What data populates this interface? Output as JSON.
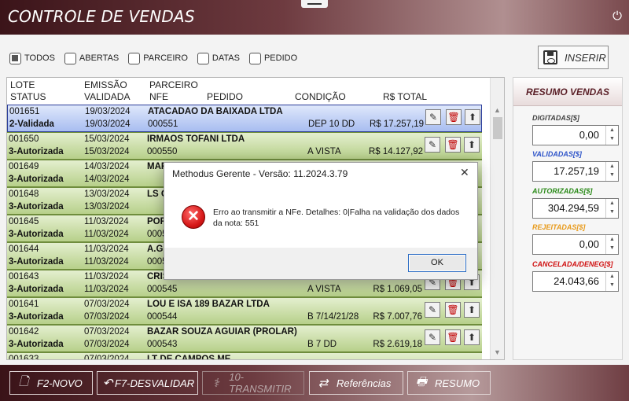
{
  "window": {
    "title": "CONTROLE DE VENDAS"
  },
  "filters": [
    {
      "label": "TODOS",
      "checked": true
    },
    {
      "label": "ABERTAS",
      "checked": false
    },
    {
      "label": "PARCEIRO",
      "checked": false
    },
    {
      "label": "DATAS",
      "checked": false
    },
    {
      "label": "PEDIDO",
      "checked": false
    }
  ],
  "toolbar": {
    "inserir_label": "INSERIR"
  },
  "grid": {
    "headers": {
      "lote": "LOTE",
      "status": "STATUS",
      "emissao": "EMISSÃO",
      "validada": "VALIDADA",
      "parceiro": "PARCEIRO",
      "nfe": "NFE",
      "pedido": "PEDIDO",
      "condicao": "CONDIÇÃO",
      "total": "R$ TOTAL"
    },
    "rows": [
      {
        "lote": "001651",
        "status": "2-Validada",
        "emissao": "19/03/2024",
        "validada": "19/03/2024",
        "parceiro": "ATACADAO DA BAIXADA LTDA",
        "nfe": "000551",
        "condicao": "DEP 10 DD",
        "total": "R$ 17.257,19",
        "selected": true
      },
      {
        "lote": "001650",
        "status": "3-Autorizada",
        "emissao": "15/03/2024",
        "validada": "15/03/2024",
        "parceiro": "IRMAOS TOFANI LTDA",
        "nfe": "000550",
        "condicao": "A VISTA",
        "total": "R$ 14.127,92"
      },
      {
        "lote": "001649",
        "status": "3-Autorizada",
        "emissao": "14/03/2024",
        "validada": "14/03/2024",
        "parceiro": "MAR",
        "nfe": "",
        "condicao": "",
        "total": ""
      },
      {
        "lote": "001648",
        "status": "3-Autorizada",
        "emissao": "13/03/2024",
        "validada": "13/03/2024",
        "parceiro": "LS G",
        "nfe": "",
        "condicao": "",
        "total": ""
      },
      {
        "lote": "001645",
        "status": "3-Autorizada",
        "emissao": "11/03/2024",
        "validada": "11/03/2024",
        "parceiro": "POR",
        "nfe": "0005",
        "condicao": "",
        "total": ""
      },
      {
        "lote": "001644",
        "status": "3-Autorizada",
        "emissao": "11/03/2024",
        "validada": "11/03/2024",
        "parceiro": "A.G.",
        "nfe": "0005",
        "condicao": "",
        "total": ""
      },
      {
        "lote": "001643",
        "status": "3-Autorizada",
        "emissao": "11/03/2024",
        "validada": "11/03/2024",
        "parceiro": "CRIS",
        "nfe": "000545",
        "condicao": "A VISTA",
        "total": "R$ 1.069,05"
      },
      {
        "lote": "001641",
        "status": "3-Autorizada",
        "emissao": "07/03/2024",
        "validada": "07/03/2024",
        "parceiro": "LOU E ISA 189 BAZAR LTDA",
        "nfe": "000544",
        "condicao": "B 7/14/21/28",
        "total": "R$ 7.007,76"
      },
      {
        "lote": "001642",
        "status": "3-Autorizada",
        "emissao": "07/03/2024",
        "validada": "07/03/2024",
        "parceiro": "BAZAR SOUZA AGUIAR (PROLAR)",
        "nfe": "000543",
        "condicao": "B 7 DD",
        "total": "R$ 2.619,18"
      },
      {
        "lote": "001633",
        "status": "",
        "emissao": "07/03/2024",
        "validada": "",
        "parceiro": "LT DE CAMPOS ME",
        "nfe": "",
        "condicao": "",
        "total": ""
      }
    ]
  },
  "resumo": {
    "title": "RESUMO VENDAS",
    "digitadas_label": "DIGITADAS[$]",
    "digitadas_value": "0,00",
    "validadas_label": "VALIDADAS[$]",
    "validadas_value": "17.257,19",
    "autorizadas_label": "AUTORIZADAS[$]",
    "autorizadas_value": "304.294,59",
    "rejeitadas_label": "REJEITADAS[$]",
    "rejeitadas_value": "0,00",
    "canceladas_label": "CANCELADA/DENEG[$]",
    "canceladas_value": "24.043,66",
    "colors": {
      "digitadas": "#444444",
      "validadas": "#2f55c9",
      "autorizadas": "#2a8a18",
      "rejeitadas": "#e89a1a",
      "canceladas": "#d01010"
    }
  },
  "bottom": {
    "novo": "F2-NOVO",
    "desvalidar": "F7-DESVALIDAR",
    "transmitir": "10-TRANSMITIR",
    "referencias": "Referências",
    "resumo": "RESUMO"
  },
  "dialog": {
    "title": "Methodus Gerente - Versão: 11.2024.3.79",
    "message": "Erro ao transmitir a NFe. Detalhes: 0|Falha na validação dos dados da nota: 551",
    "ok": "OK"
  }
}
